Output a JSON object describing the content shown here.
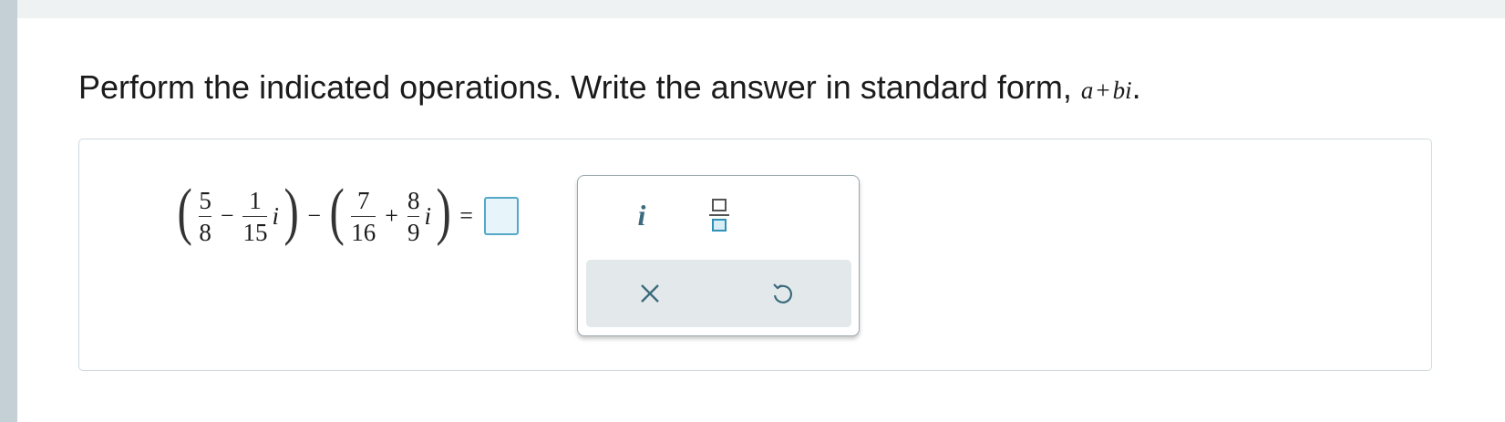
{
  "instruction": {
    "text": "Perform the indicated operations. Write the answer in standard form,",
    "form_a": "a",
    "form_plus": "+",
    "form_bi": "bi",
    "period": "."
  },
  "expression": {
    "open_paren": "(",
    "close_paren": ")",
    "term1_num": "5",
    "term1_den": "8",
    "minus": "−",
    "term2_num": "1",
    "term2_den": "15",
    "imag_unit": "i",
    "middle_minus": "−",
    "term3_num": "7",
    "term3_den": "16",
    "plus": "+",
    "term4_num": "8",
    "term4_den": "9",
    "equals": "="
  },
  "palette": {
    "imag_button_label": "i",
    "fraction_button_icon": "fraction-template-icon",
    "clear_icon": "close-icon",
    "undo_icon": "undo-icon"
  },
  "colors": {
    "accent": "#54a8c7",
    "palette_icon": "#3b6b7d",
    "action_bar": "#e3e9eb"
  }
}
